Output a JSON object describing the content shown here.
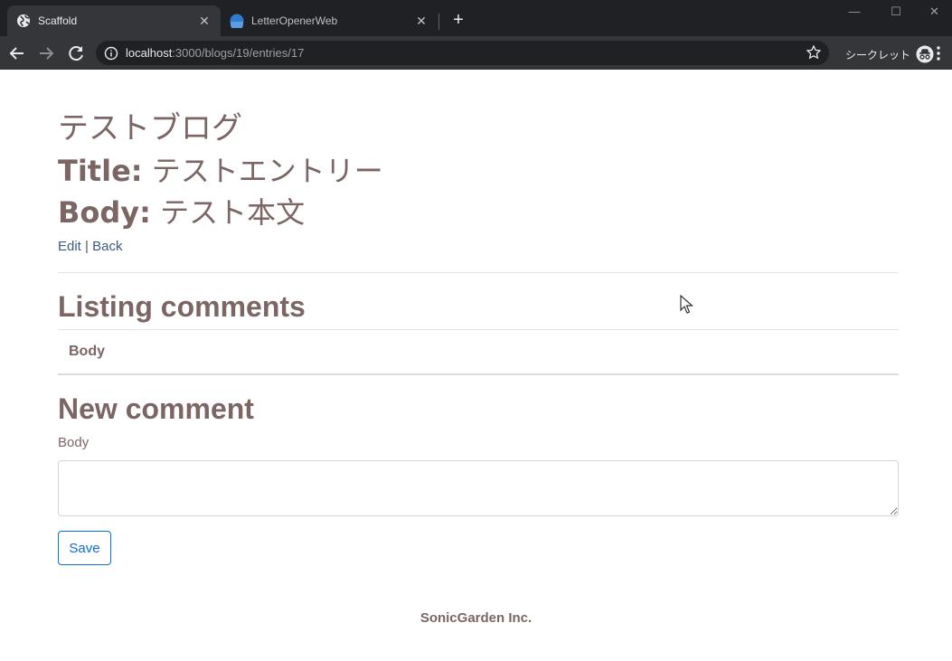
{
  "browser": {
    "tabs": [
      {
        "title": "Scaffold",
        "active": true,
        "icon": "globe-icon"
      },
      {
        "title": "LetterOpenerWeb",
        "active": false,
        "icon": "blue-circle-icon"
      }
    ],
    "close_glyph": "✕",
    "new_tab_glyph": "+",
    "window_controls": {
      "minimize": "—",
      "maximize": "☐",
      "close": "✕"
    },
    "url": {
      "host": "localhost",
      "rest": ":3000/blogs/19/entries/17"
    },
    "incognito_label": "シークレット"
  },
  "page": {
    "blog_title": "テストブログ",
    "entry": {
      "title_label": "Title:",
      "title_value": "テストエントリー",
      "body_label": "Body:",
      "body_value": "テスト本文"
    },
    "links": {
      "edit": "Edit",
      "separator": "|",
      "back": "Back"
    },
    "comments": {
      "heading": "Listing comments",
      "columns": [
        "Body"
      ],
      "rows": []
    },
    "new_comment": {
      "heading": "New comment",
      "body_label": "Body",
      "body_value": "",
      "save_label": "Save"
    },
    "footer": "SonicGarden Inc."
  },
  "colors": {
    "text": "#7b6663",
    "link": "#3d5a80",
    "button_accent": "#0b6fd3",
    "chrome_dark": "#202124",
    "chrome_toolbar": "#35363a"
  }
}
